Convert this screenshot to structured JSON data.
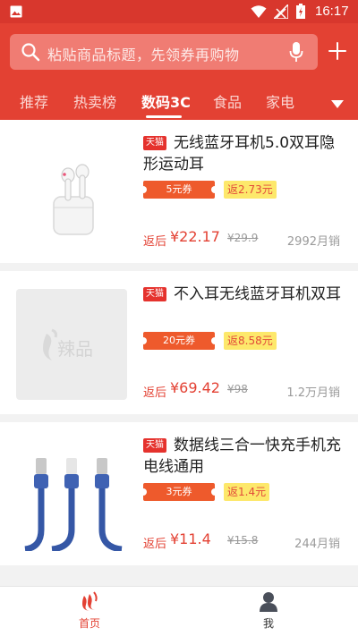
{
  "status_bar": {
    "time": "16:17"
  },
  "search": {
    "placeholder": "粘贴商品标题，先领券再购物"
  },
  "tabs": [
    {
      "label": "推荐"
    },
    {
      "label": "热卖榜"
    },
    {
      "label": "数码3C",
      "active": true
    },
    {
      "label": "食品"
    },
    {
      "label": "家电"
    }
  ],
  "products": [
    {
      "badge": "天猫",
      "title": "无线蓝牙耳机5.0双耳隐形运动耳",
      "coupon": "5元券",
      "rebate": "返2.73元",
      "price_label": "返后",
      "price": "¥22.17",
      "original_price": "¥29.9",
      "sales": "2992月销"
    },
    {
      "badge": "天猫",
      "title": "不入耳无线蓝牙耳机双耳",
      "coupon": "20元券",
      "rebate": "返8.58元",
      "price_label": "返后",
      "price": "¥69.42",
      "original_price": "¥98",
      "sales": "1.2万月销",
      "placeholder_logo": "辣品"
    },
    {
      "badge": "天猫",
      "title": "数据线三合一快充手机充电线通用",
      "coupon": "3元券",
      "rebate": "返1.4元",
      "price_label": "返后",
      "price": "¥11.4",
      "original_price": "¥15.8",
      "sales": "244月销"
    }
  ],
  "bottom_nav": [
    {
      "label": "首页",
      "active": true
    },
    {
      "label": "我"
    }
  ],
  "colors": {
    "brand_red": "#e34133",
    "status_red": "#d8372d",
    "coupon_orange": "#ee5a2c",
    "rebate_yellow": "#fde86b"
  }
}
